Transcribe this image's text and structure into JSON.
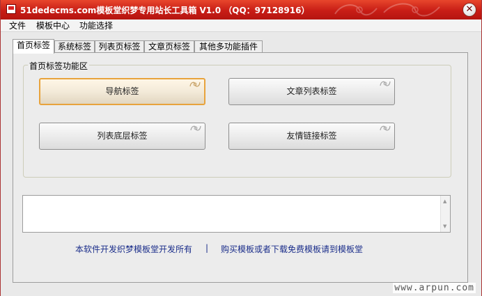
{
  "window": {
    "title": "51dedecms.com模板堂织梦专用站长工具箱 V1.0 （QQ：97128916）",
    "close_glyph": "✕",
    "title_color": "#c81d16"
  },
  "menu": {
    "items": [
      {
        "label": "文件"
      },
      {
        "label": "模板中心"
      },
      {
        "label": "功能选择"
      }
    ]
  },
  "tabs": [
    {
      "label": "首页标签",
      "active": true
    },
    {
      "label": "系统标签"
    },
    {
      "label": "列表页标签"
    },
    {
      "label": "文章页标签"
    },
    {
      "label": "其他多功能插件"
    }
  ],
  "panel": {
    "group_title": "首页标签功能区",
    "buttons": [
      {
        "label": "导航标签"
      },
      {
        "label": "文章列表标签"
      },
      {
        "label": "列表底层标签"
      },
      {
        "label": "友情链接标签"
      }
    ],
    "output_text": ""
  },
  "footer": {
    "left_link": "本软件开发织梦模板堂开发所有",
    "separator": "|",
    "right_link": "购买模板或者下载免费模板请到模板堂"
  },
  "watermark": "www.arpun.com",
  "icons": {
    "app": "app-icon",
    "close": "close-icon",
    "scroll_up": "scroll-up-icon",
    "scroll_down": "scroll-down-icon"
  }
}
